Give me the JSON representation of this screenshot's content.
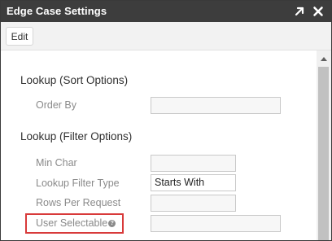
{
  "window": {
    "title": "Edge Case Settings",
    "icons": [
      "expand-arrow-icon",
      "close-icon"
    ]
  },
  "toolbar": {
    "edit_label": "Edit"
  },
  "sections": {
    "sort": {
      "title": "Lookup (Sort Options)",
      "order_by_label": "Order By",
      "order_by_value": ""
    },
    "filter": {
      "title": "Lookup (Filter Options)",
      "min_char_label": "Min Char",
      "min_char_value": "",
      "filter_type_label": "Lookup Filter Type",
      "filter_type_value": "Starts With",
      "rows_per_request_label": "Rows Per Request",
      "rows_per_request_value": "",
      "user_selectable_label": "User Selectable",
      "user_selectable_value": ""
    }
  },
  "colors": {
    "titlebar": "#3d3d3d",
    "highlight": "#d83a3a",
    "label": "#8a8a8a"
  }
}
